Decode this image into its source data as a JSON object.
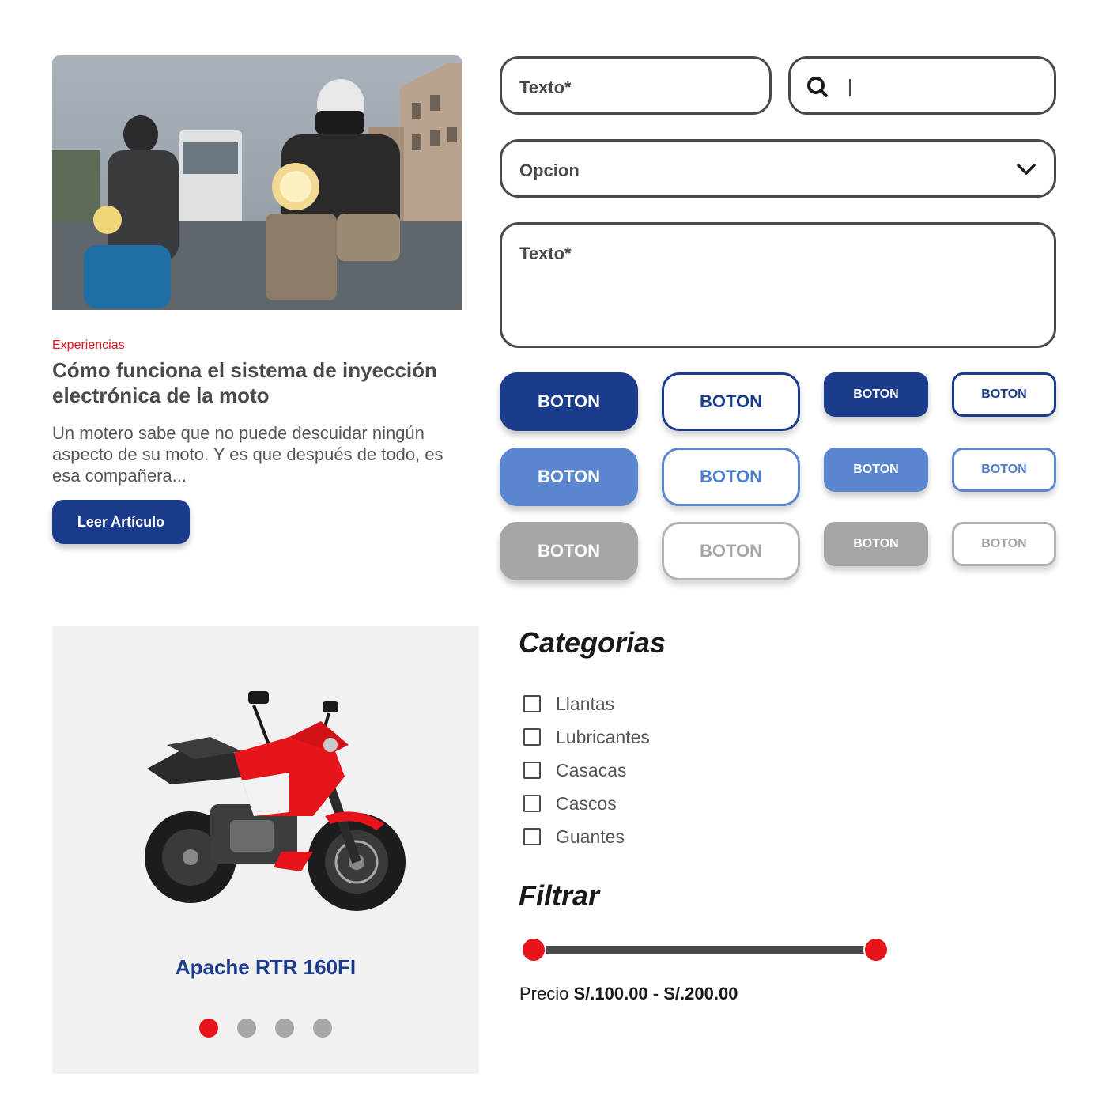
{
  "article": {
    "tag": "Experiencias",
    "title": "Cómo funciona el sistema de inyección electrónica de la moto",
    "excerpt": "Un motero sabe que no puede descuidar ningún aspecto de su moto. Y es que después de todo, es esa compañera...",
    "button_label": "Leer Artículo"
  },
  "form": {
    "text_input_label": "Texto*",
    "search_value": "",
    "select_value": "Opcion",
    "textarea_label": "Texto*"
  },
  "buttons": {
    "label": "BOTON"
  },
  "product": {
    "name": "Apache RTR 160FI",
    "carousel_dots": 4,
    "active_dot": 1
  },
  "categories": {
    "title": "Categorias",
    "items": [
      "Llantas",
      "Lubricantes",
      "Casacas",
      "Cascos",
      "Guantes"
    ]
  },
  "filter": {
    "title": "Filtrar",
    "price_label": "Precio",
    "min_price": "S/.100.00",
    "separator": "-",
    "max_price": "S/.200.00"
  },
  "colors": {
    "primary": "#1b3c8c",
    "primary_light": "#5b87d0",
    "disabled": "#a6a6a6",
    "accent": "#e8141c",
    "text": "#4a4a4a"
  }
}
